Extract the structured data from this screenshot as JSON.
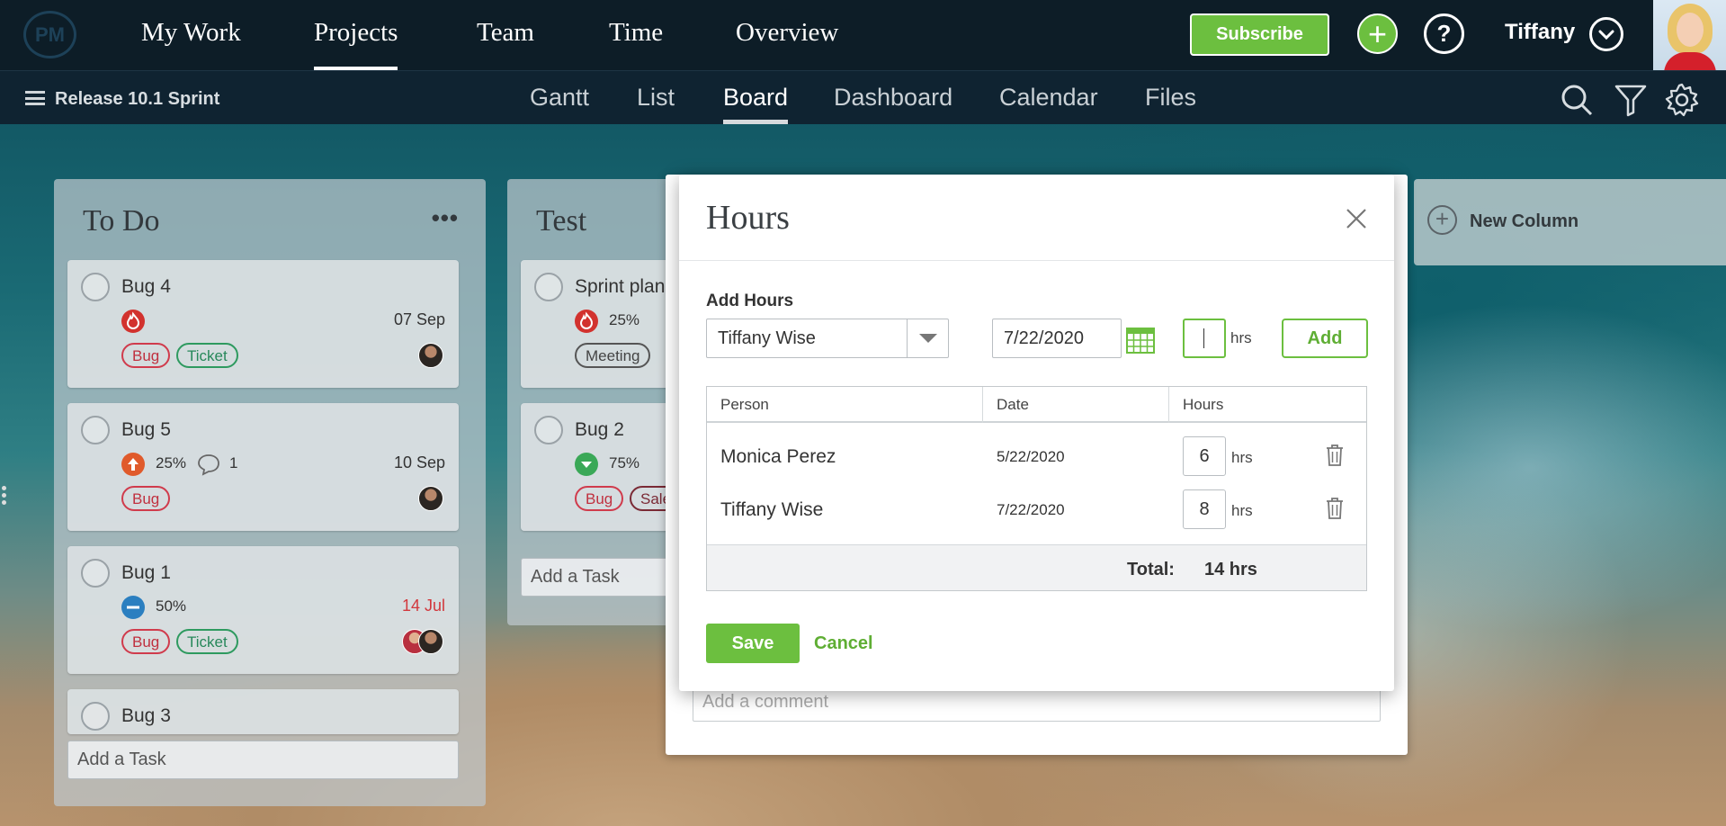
{
  "topnav": {
    "logo": "PM",
    "items": [
      {
        "label": "My Work"
      },
      {
        "label": "Projects"
      },
      {
        "label": "Team"
      },
      {
        "label": "Time"
      },
      {
        "label": "Overview"
      }
    ],
    "subscribe_label": "Subscribe",
    "user_name": "Tiffany"
  },
  "subnav": {
    "project_name": "Release 10.1 Sprint",
    "tabs": [
      {
        "label": "Gantt"
      },
      {
        "label": "List"
      },
      {
        "label": "Board"
      },
      {
        "label": "Dashboard"
      },
      {
        "label": "Calendar"
      },
      {
        "label": "Files"
      }
    ]
  },
  "board": {
    "columns": [
      {
        "title": "To Do",
        "cards": [
          {
            "title": "Bug 4",
            "date": "07 Sep",
            "tags": [
              "Bug",
              "Ticket"
            ]
          },
          {
            "title": "Bug 5",
            "percent": "25%",
            "comments": "1",
            "date": "10 Sep",
            "tags": [
              "Bug"
            ]
          },
          {
            "title": "Bug 1",
            "percent": "50%",
            "date": "14 Jul",
            "tags": [
              "Bug",
              "Ticket"
            ]
          },
          {
            "title": "Bug 3"
          }
        ],
        "add_task": "Add a Task"
      },
      {
        "title": "Test",
        "cards": [
          {
            "title": "Sprint plan",
            "percent": "25%",
            "tags": [
              "Meeting"
            ]
          },
          {
            "title": "Bug 2",
            "percent": "75%",
            "tags": [
              "Bug",
              "Sale"
            ]
          }
        ],
        "add_task": "Add a Task"
      }
    ],
    "new_column_label": "New Column"
  },
  "task_panel": {
    "comment_placeholder": "Add a comment"
  },
  "hours_modal": {
    "title": "Hours",
    "add_hours_label": "Add Hours",
    "selected_person": "Tiffany Wise",
    "date_value": "7/22/2020",
    "hrs_value": "",
    "unit": "hrs",
    "add_button": "Add",
    "table": {
      "headers": [
        "Person",
        "Date",
        "Hours"
      ],
      "rows": [
        {
          "person": "Monica Perez",
          "date": "5/22/2020",
          "hours": "6",
          "unit": "hrs"
        },
        {
          "person": "Tiffany Wise",
          "date": "7/22/2020",
          "hours": "8",
          "unit": "hrs"
        }
      ],
      "total_label": "Total:",
      "total_value": "14 hrs"
    },
    "save_button": "Save",
    "cancel_button": "Cancel"
  },
  "colors": {
    "accent_green": "#6cbf3f",
    "topbar": "#0d1d27",
    "tag_red": "#d03b4c",
    "tag_green": "#2e9a5f",
    "overdue": "#d2373c"
  }
}
